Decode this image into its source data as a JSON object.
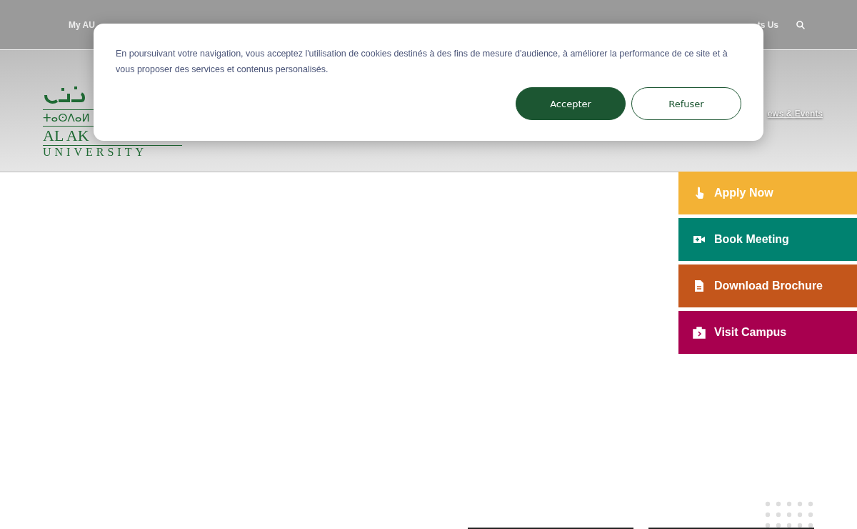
{
  "top_nav": {
    "items": [
      {
        "label": "My AU"
      },
      {
        "label": "ts Us"
      }
    ]
  },
  "logo": {
    "tifinagh": "ⵜⴰⵙⴷⴰⵍ",
    "name": "AL AK",
    "subtitle": "UNIVERSITY"
  },
  "main_nav": {
    "items": [
      {
        "label": "ews & Events"
      }
    ]
  },
  "cookie_banner": {
    "message": "En poursuivant votre navigation, vous acceptez l'utilisation de cookies destinés à des fins de mesure d'audience, à améliorer la performance de ce site et à vous proposer des services et contenus personalisés.",
    "buttons": [
      {
        "label": "Accepter",
        "kind": "primary"
      },
      {
        "label": "Refuser",
        "kind": "secondary"
      }
    ]
  },
  "quick_links": [
    {
      "label": "Apply Now",
      "kind": "apply",
      "color": "#f3b235"
    },
    {
      "label": "Book Meeting",
      "kind": "meeting",
      "color": "#008270"
    },
    {
      "label": "Download Brochure",
      "kind": "brochure",
      "color": "#c4561b"
    },
    {
      "label": "Visit Campus",
      "kind": "visit",
      "color": "#a8004f"
    }
  ]
}
